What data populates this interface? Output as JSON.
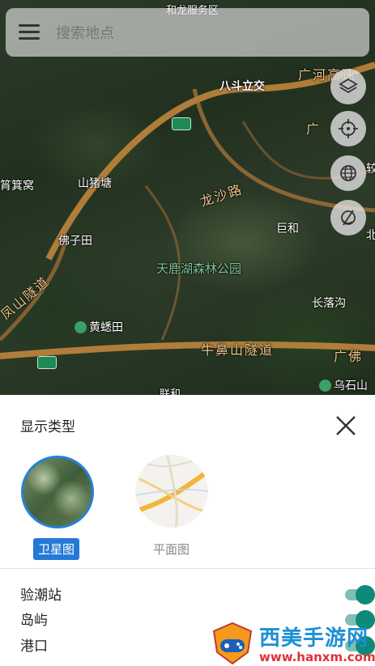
{
  "search": {
    "placeholder": "搜索地点"
  },
  "map_labels": {
    "district": "和龙服务区",
    "road_top": "广河高速",
    "interchange": "八斗立交",
    "road_right": "广",
    "place_left": "筲箕窝",
    "place_shanzhu": "山猪塘",
    "road_longsha": "龙沙路",
    "place_bei": "北",
    "place_jiang": "较",
    "place_juhe": "巨和",
    "place_fozitian": "佛子田",
    "park": "天鹿湖森林公园",
    "tunnel_left": "凤山隧道",
    "place_changluo": "长落沟",
    "poi_huangqitian": "黄蟋田",
    "tunnel_bottom": "牛鼻山隧道",
    "road_guangfo": "广佛",
    "poi_wushishan": "乌石山",
    "place_bottom": "联和"
  },
  "icons": {
    "menu": "menu-icon",
    "layers": "layers-icon",
    "locate": "locate-icon",
    "globe": "globe-icon",
    "tilt": "view-tilt-icon",
    "close": "close-icon",
    "watermark_logo": "gamepad-shield-icon"
  },
  "sheet": {
    "title": "显示类型",
    "types": [
      {
        "label": "卫星图",
        "selected": true
      },
      {
        "label": "平面图",
        "selected": false
      }
    ],
    "toggles": [
      {
        "label": "验潮站",
        "on": true
      },
      {
        "label": "岛屿",
        "on": true
      },
      {
        "label": "港口",
        "on": true
      }
    ]
  },
  "watermark": {
    "title": "西美手游网",
    "url": "www.hanxm.com"
  },
  "colors": {
    "accent": "#2579d6",
    "toggle_on": "#0f8a78",
    "map_bg": "#2c3a2a"
  }
}
